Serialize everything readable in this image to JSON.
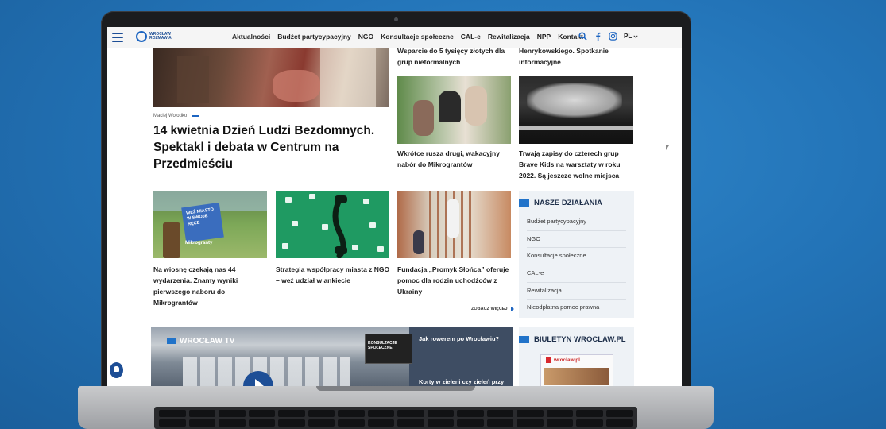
{
  "site": {
    "logo_text": "WROCŁAW ROZMAWIA",
    "nav": [
      "Aktualności",
      "Budżet partycypacyjny",
      "NGO",
      "Konsultacje społeczne",
      "CAL-e",
      "Rewitalizacja",
      "NPP",
      "Kontakt"
    ],
    "lang": "PL"
  },
  "main_article": {
    "author": "Maciej Wołodko",
    "headline": "14 kwietnia Dzień Ludzi Bezdomnych. Spektakl i debata w Centrum na Przedmieściu"
  },
  "top_captions": {
    "left": "Wsparcie do 5 tysięcy złotych dla grup nieformalnych",
    "right": "Henrykowskiego. Spotkanie informacyjne"
  },
  "cards_row1": [
    {
      "caption": "Wkrótce rusza drugi, wakacyjny nabór do Mikrograntów"
    },
    {
      "caption": "Trwają zapisy do czterech grup Brave Kids na warsztaty w roku 2022. Są jeszcze wolne miejsca"
    }
  ],
  "cards_row2": [
    {
      "caption": "Na wiosnę czekają nas 44 wydarzenia. Znamy wyniki pierwszego naboru do Mikrograntów",
      "img_text": "WEŹ MIASTO W SWOJE RĘCE",
      "img_text2": "Mikrogranty"
    },
    {
      "caption": "Strategia współpracy miasta z NGO – weź udział w ankiecie"
    },
    {
      "caption": "Fundacja „Promyk Słońca” oferuje pomoc dla rodzin uchodźców z Ukrainy"
    }
  ],
  "see_more": "ZOBACZ WIĘCEJ",
  "sidebar": {
    "title": "NASZE DZIAŁANIA",
    "items": [
      "Budżet partycypacyjny",
      "NGO",
      "Konsultacje społeczne",
      "CAL-e",
      "Rewitalizacja",
      "Nieodpłatna pomoc prawna"
    ]
  },
  "newsletter": {
    "title": "BIULETYN WROCLAW.PL",
    "thumb_text": "wroclaw.pl"
  },
  "tv": {
    "label": "WROCŁAW TV",
    "items": [
      "Jak rowerem po Wrocławiu?",
      "Kortу w zieleni czy zieleń przy"
    ],
    "thumb_text": "KONSULTACJE SPOŁECZNE"
  },
  "colors": {
    "brand": "#1d4e96",
    "accent": "#2173c9"
  }
}
